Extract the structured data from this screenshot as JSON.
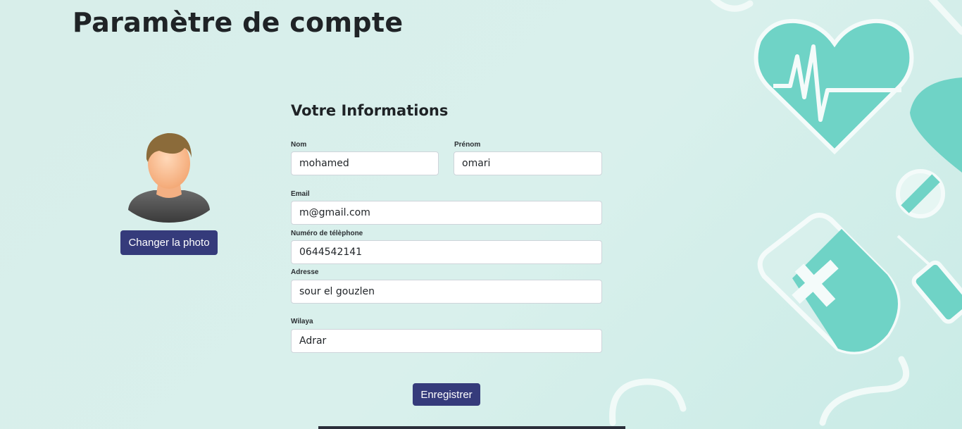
{
  "page": {
    "title": "Paramètre de compte"
  },
  "profile": {
    "change_photo_label": "Changer la photo"
  },
  "form": {
    "section_title": "Votre Informations",
    "nom": {
      "label": "Nom",
      "value": "mohamed"
    },
    "prenom": {
      "label": "Prénom",
      "value": "omari"
    },
    "email": {
      "label": "Email",
      "value": "m@gmail.com"
    },
    "telephone": {
      "label": "Numéro de télèphone",
      "value": "0644542141"
    },
    "adresse": {
      "label": "Adresse",
      "value": "sour el gouzlen"
    },
    "wilaya": {
      "label": "Wilaya",
      "value": "Adrar"
    },
    "submit_label": "Enregistrer"
  },
  "theme": {
    "accent": "#353b7b",
    "background": "#d8eeea",
    "illustration": "#6fd3c6"
  },
  "icons": {
    "avatar": "user-avatar-icon",
    "background": "medical-illustration"
  }
}
